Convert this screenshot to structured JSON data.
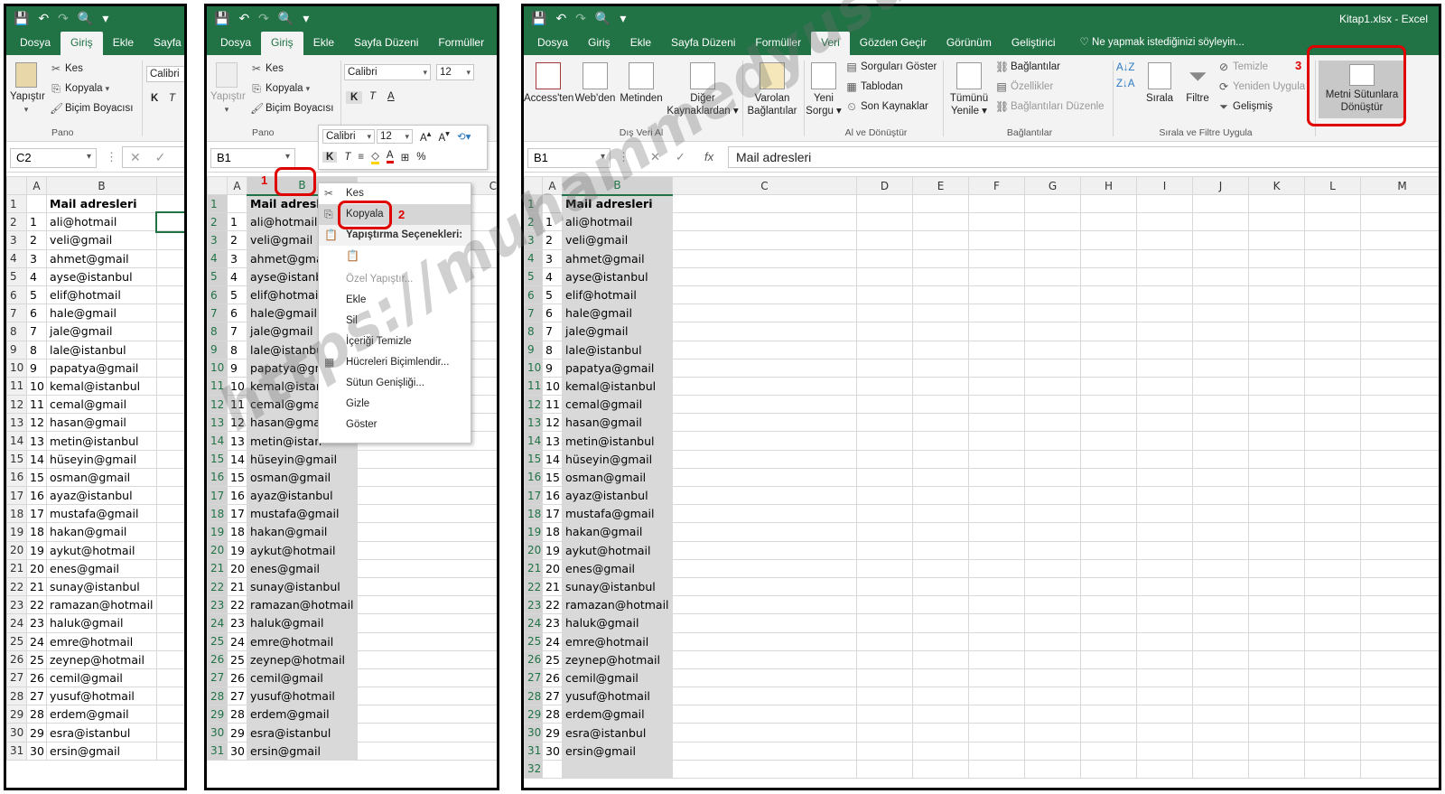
{
  "qat": {
    "save": "💾",
    "undo": "↶",
    "redo": "↷",
    "preview": "🔍",
    "more": "▾"
  },
  "window_title": "Kitap1.xlsx - Excel",
  "tabs_p1": [
    "Dosya",
    "Giriş",
    "Ekle",
    "Sayfa"
  ],
  "tabs_p2": [
    "Dosya",
    "Giriş",
    "Ekle",
    "Sayfa Düzeni",
    "Formüller"
  ],
  "tabs_p3": [
    "Dosya",
    "Giriş",
    "Ekle",
    "Sayfa Düzeni",
    "Formüller",
    "Veri",
    "Gözden Geçir",
    "Görünüm",
    "Geliştirici"
  ],
  "tell_me": "Ne yapmak istediğinizi söyleyin...",
  "home": {
    "paste": "Yapıştır",
    "cut": "Kes",
    "copy": "Kopyala",
    "format_painter": "Biçim Boyacısı",
    "clipboard_group": "Pano",
    "font_name": "Calibri",
    "font_size": "12",
    "bold": "K",
    "italic": "T",
    "underline": "A"
  },
  "data_ribbon": {
    "access": "Access'ten",
    "web": "Web'den",
    "text": "Metinden",
    "other_sources": "Diğer Kaynaklardan ▾",
    "existing_conn": "Varolan Bağlantılar",
    "ext_group": "Dış Veri Al",
    "new_query": "Yeni Sorgu ▾",
    "show_queries": "Sorguları Göster",
    "from_table": "Tablodan",
    "recent_sources": "Son Kaynaklar",
    "transform_group": "Al ve Dönüştür",
    "refresh_all": "Tümünü Yenile ▾",
    "connections": "Bağlantılar",
    "properties": "Özellikler",
    "edit_links": "Bağlantıları Düzenle",
    "conn_group": "Bağlantılar",
    "sort": "Sırala",
    "filter": "Filtre",
    "clear": "Temizle",
    "reapply": "Yeniden Uygula",
    "advanced": "Gelişmiş",
    "sort_group": "Sırala ve Filtre Uygula",
    "text_to_columns": "Metni Sütunlara Dönüştür"
  },
  "namebox": {
    "p1": "C2",
    "p2": "B1",
    "p3": "B1"
  },
  "formula_value": "Mail adresleri",
  "header_text": "Mail adresleri",
  "columns_p3": [
    "A",
    "B",
    "C",
    "D",
    "E",
    "F",
    "G",
    "H",
    "I",
    "J",
    "K",
    "L",
    "M"
  ],
  "emails": [
    "ali@hotmail",
    "veli@gmail",
    "ahmet@gmail",
    "ayse@istanbul",
    "elif@hotmail",
    "hale@gmail",
    "jale@gmail",
    "lale@istanbul",
    "papatya@gmail",
    "kemal@istanbul",
    "cemal@gmail",
    "hasan@gmail",
    "metin@istanbul",
    "hüseyin@gmail",
    "osman@gmail",
    "ayaz@istanbul",
    "mustafa@gmail",
    "hakan@gmail",
    "aykut@hotmail",
    "enes@gmail",
    "sunay@istanbul",
    "ramazan@hotmail",
    "haluk@gmail",
    "emre@hotmail",
    "zeynep@hotmail",
    "cemil@gmail",
    "yusuf@hotmail",
    "erdem@gmail",
    "esra@istanbul",
    "ersin@gmail"
  ],
  "emails_p2_truncated": [
    "ali@hotmail",
    "veli@gmail",
    "ahmet@gma",
    "ayse@istanb",
    "elif@hotmai",
    "hale@gmail",
    "jale@gmail",
    "lale@istanbu",
    "papatya@gm",
    "kemal@istan",
    "cemal@gma",
    "hasan@gma",
    "metin@istan"
  ],
  "context_menu": {
    "cut": "Kes",
    "copy": "Kopyala",
    "paste_options": "Yapıştırma Seçenekleri:",
    "paste_special": "Özel Yapıştır...",
    "insert": "Ekle",
    "delete": "Sil",
    "clear_contents": "İçeriği Temizle",
    "format_cells": "Hücreleri Biçimlendir...",
    "column_width": "Sütun Genişliği...",
    "hide": "Gizle",
    "unhide": "Göster"
  },
  "step_numbers": [
    "1",
    "2",
    "3"
  ],
  "watermark": "https://muhammedyusufolgun.blogspot.com"
}
